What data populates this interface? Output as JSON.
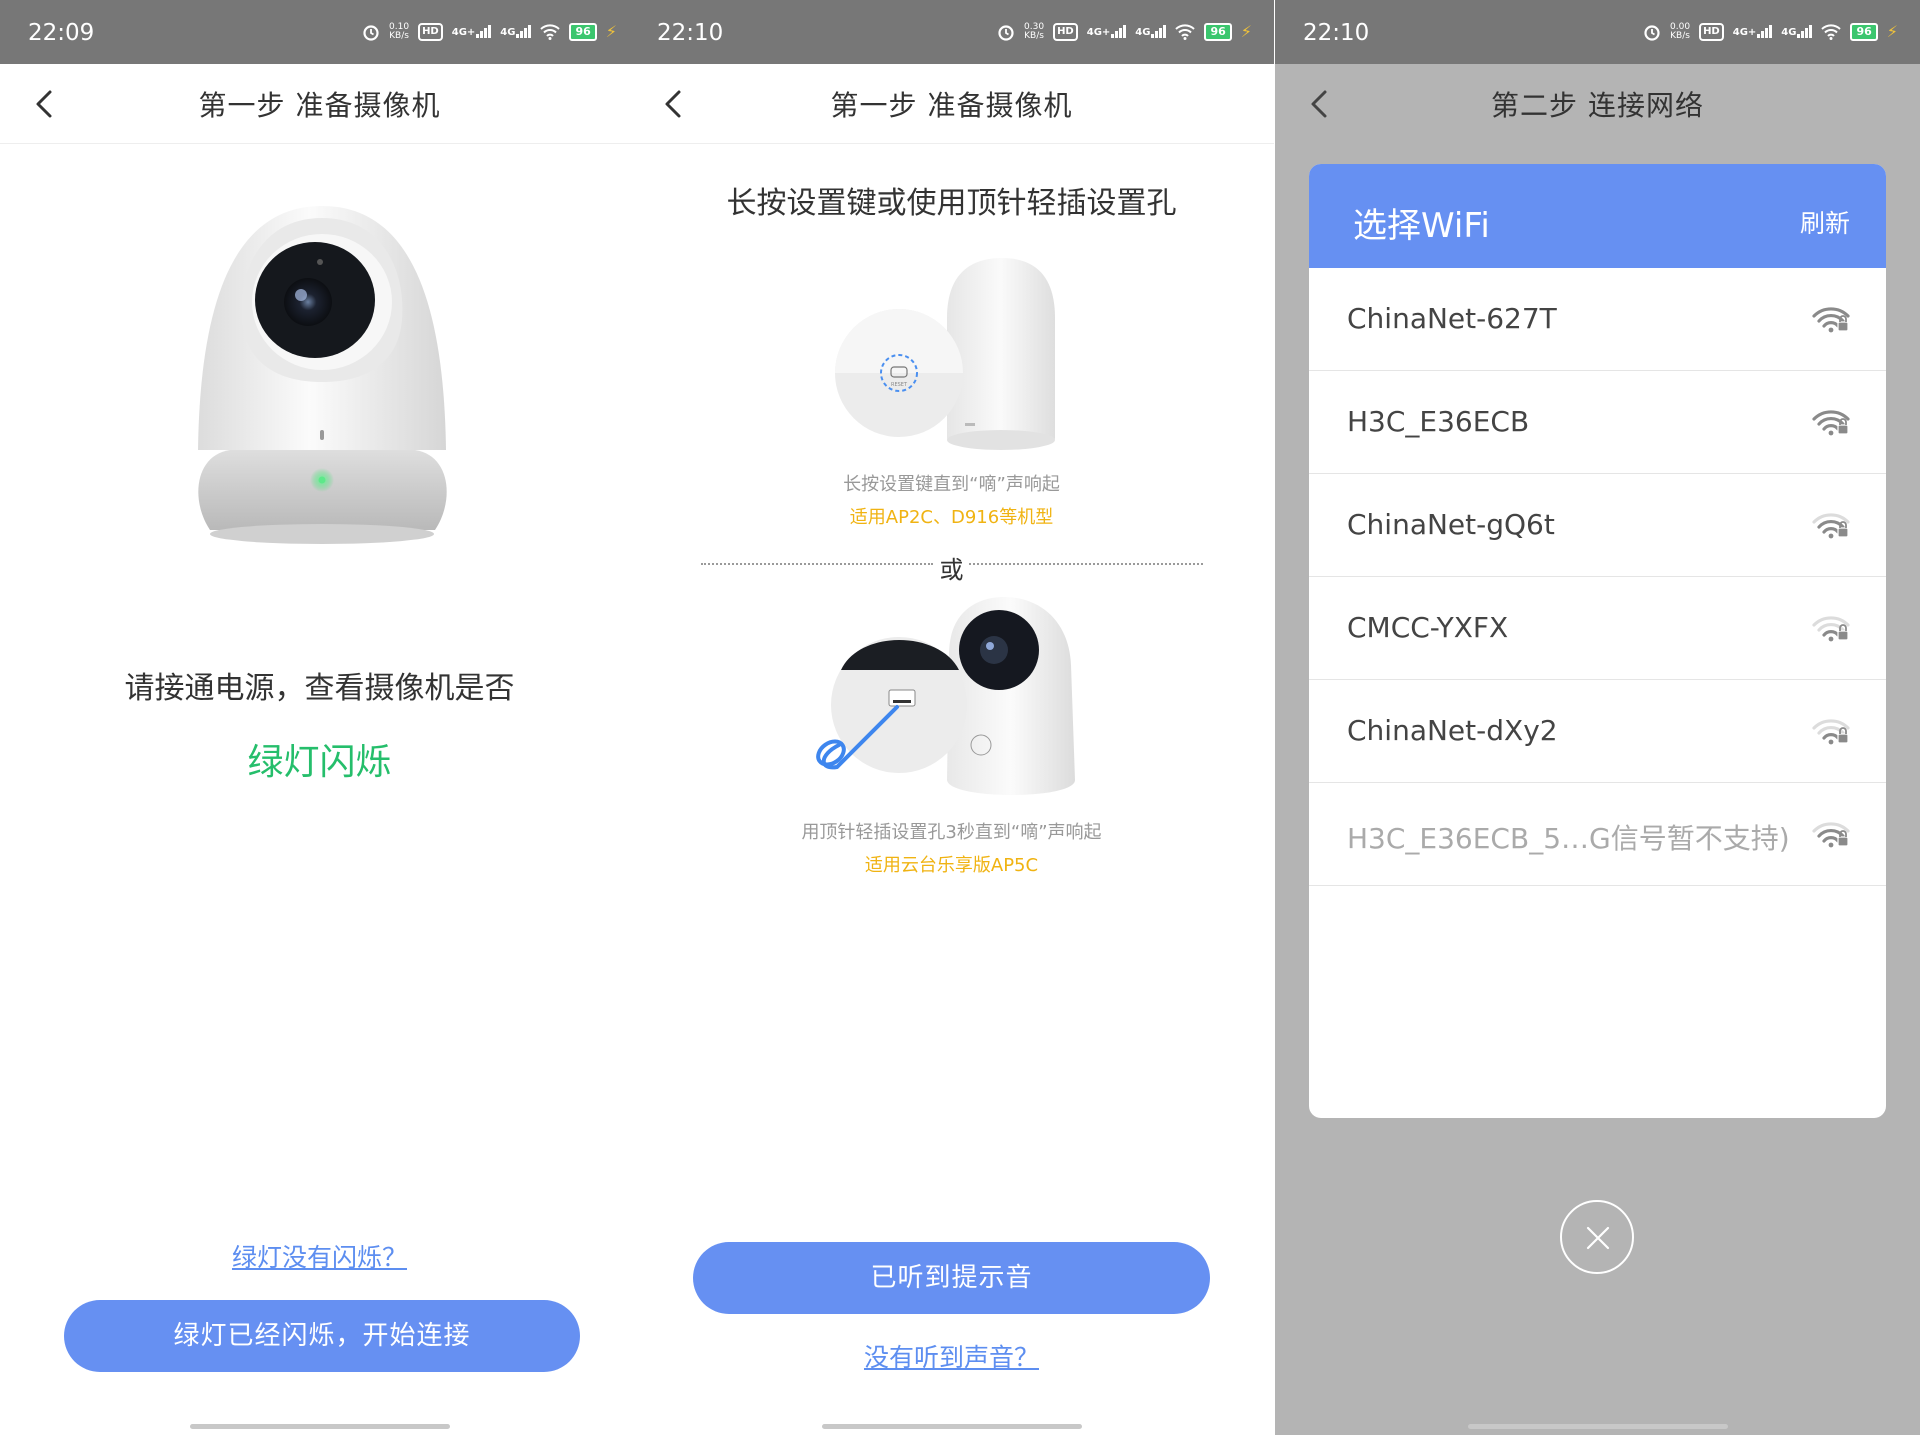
{
  "screens": [
    {
      "status": {
        "time": "22:09",
        "netspeed": "0.10",
        "netspeed_unit": "KB/s",
        "hd": "HD",
        "sig1": "4G+",
        "sig2": "4G",
        "battery": "96"
      },
      "nav": {
        "title": "第一步 准备摄像机"
      },
      "instruction": "请接通电源，查看摄像机是否",
      "highlight": "绿灯闪烁",
      "help_link": "绿灯没有闪烁？",
      "primary_button": "绿灯已经闪烁，开始连接"
    },
    {
      "status": {
        "time": "22:10",
        "netspeed": "0.30",
        "netspeed_unit": "KB/s",
        "hd": "HD",
        "sig1": "4G+",
        "sig2": "4G",
        "battery": "96"
      },
      "nav": {
        "title": "第一步 准备摄像机"
      },
      "instruction": "长按设置键或使用顶针轻插设置孔",
      "method1": {
        "caption": "长按设置键直到“嘀”声响起",
        "models": "适用AP2C、D916等机型"
      },
      "or_label": "或",
      "method2": {
        "caption": "用顶针轻插设置孔3秒直到“嘀”声响起",
        "models": "适用云台乐享版AP5C"
      },
      "primary_button": "已听到提示音",
      "help_link": "没有听到声音？"
    },
    {
      "status": {
        "time": "22:10",
        "netspeed": "0.00",
        "netspeed_unit": "KB/s",
        "hd": "HD",
        "sig1": "4G+",
        "sig2": "4G",
        "battery": "96"
      },
      "nav": {
        "title": "第二步 连接网络"
      },
      "wifi": {
        "title": "选择WiFi",
        "refresh": "刷新",
        "networks": [
          {
            "ssid": "ChinaNet-627T",
            "signal": 3
          },
          {
            "ssid": "H3C_E36ECB",
            "signal": 3
          },
          {
            "ssid": "ChinaNet-gQ6t",
            "signal": 2
          },
          {
            "ssid": "CMCC-YXFX",
            "signal": 1
          },
          {
            "ssid": "ChinaNet-dXy2",
            "signal": 1
          },
          {
            "ssid": "H3C_E36ECB_5…G信号暂不支持)",
            "signal": 2,
            "disabled": true
          }
        ]
      }
    }
  ],
  "colors": {
    "accent": "#6690f2",
    "green": "#25be6b",
    "yellow": "#f0b312",
    "statusbar": "#777777",
    "overlay": "#b4b4b4"
  },
  "icons": {
    "back": "chevron-left-icon",
    "alarm": "alarm-icon",
    "wifi_status": "wifi-icon",
    "lock": "wifi-lock-icon",
    "close": "close-icon"
  }
}
